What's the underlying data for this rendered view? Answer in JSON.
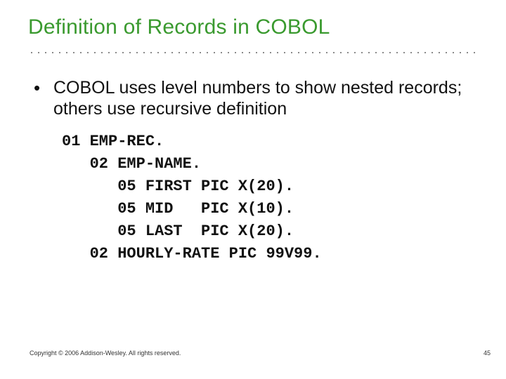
{
  "title": "Definition of Records in COBOL",
  "bullet": {
    "mark": "•",
    "text": "COBOL uses level numbers to show nested records; others use recursive definition"
  },
  "code": "01 EMP-REC.\n   02 EMP-NAME.\n      05 FIRST PIC X(20).\n      05 MID   PIC X(10).\n      05 LAST  PIC X(20).\n   02 HOURLY-RATE PIC 99V99.",
  "footer": {
    "copyright": "Copyright © 2006 Addison-Wesley. All rights reserved.",
    "page": "45"
  }
}
